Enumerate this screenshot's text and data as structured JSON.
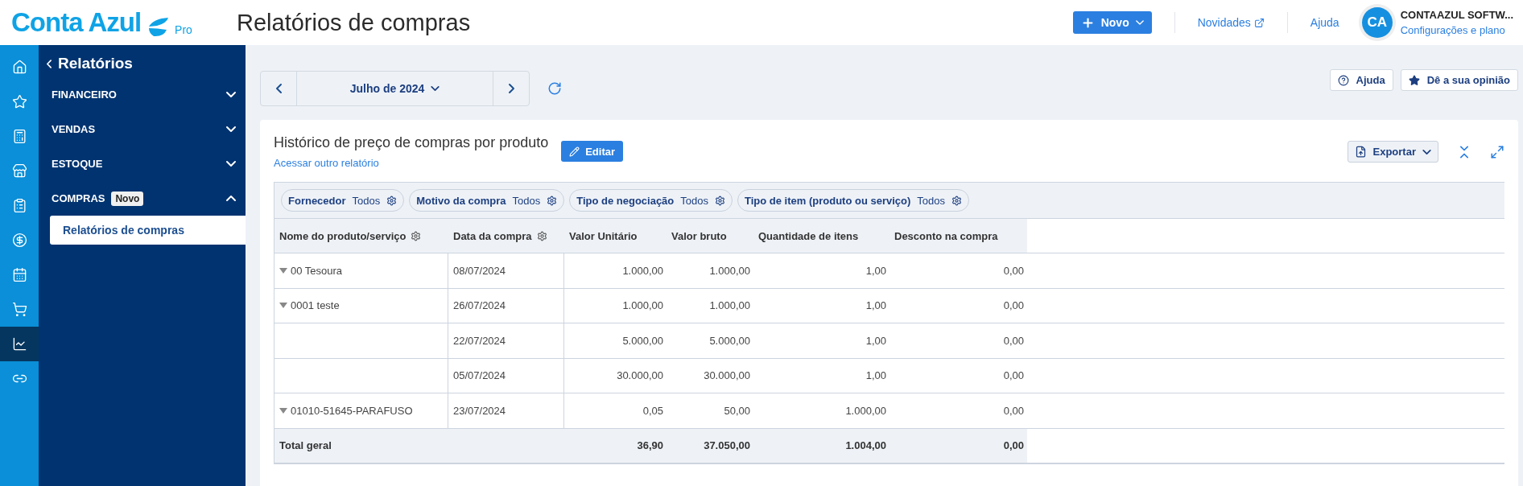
{
  "header": {
    "logo": {
      "text": "Conta Azul",
      "tier": "Pro"
    },
    "page_title": "Relatórios de compras",
    "new_button": "Novo",
    "links": [
      {
        "label": "Novidades",
        "external": true
      },
      {
        "label": "Ajuda",
        "external": false
      }
    ],
    "user": {
      "initials": "CA",
      "name": "CONTAAZUL SOFTW...",
      "subtitle": "Configurações e plano"
    }
  },
  "rail": {
    "items": [
      {
        "kind": "home",
        "selected": false
      },
      {
        "kind": "star",
        "selected": false
      },
      {
        "kind": "register",
        "selected": false
      },
      {
        "kind": "store",
        "selected": false
      },
      {
        "kind": "clipboard",
        "selected": false
      },
      {
        "kind": "money",
        "selected": false
      },
      {
        "kind": "calendar",
        "selected": false
      },
      {
        "kind": "cart",
        "selected": false
      },
      {
        "kind": "chart",
        "selected": true
      },
      {
        "kind": "link",
        "selected": false
      }
    ]
  },
  "nav": {
    "title": "Relatórios",
    "sections": [
      {
        "label": "FINANCEIRO",
        "expanded": false
      },
      {
        "label": "VENDAS",
        "expanded": false
      },
      {
        "label": "ESTOQUE",
        "expanded": false
      },
      {
        "label": "COMPRAS",
        "badge": "Novo",
        "expanded": true,
        "children": [
          {
            "label": "Relatórios de compras",
            "selected": true
          }
        ]
      }
    ]
  },
  "toolbar": {
    "period": "Julho de 2024",
    "actions": [
      {
        "kind": "help",
        "label": "Ajuda"
      },
      {
        "kind": "feedback",
        "label": "Dê a sua opinião"
      }
    ]
  },
  "report": {
    "title": "Histórico de preço de compras por produto",
    "link": "Acessar outro relatório",
    "edit_button": "Editar",
    "export_button": "Exportar",
    "filters": [
      {
        "label": "Fornecedor",
        "value": "Todos"
      },
      {
        "label": "Motivo da compra",
        "value": "Todos"
      },
      {
        "label": "Tipo de negociação",
        "value": "Todos"
      },
      {
        "label": "Tipo de item (produto ou serviço)",
        "value": "Todos"
      }
    ],
    "columns": [
      {
        "label": "Nome do produto/serviço",
        "settings": true
      },
      {
        "label": "Data da compra",
        "settings": true
      },
      {
        "label": "Valor Unitário",
        "settings": false
      },
      {
        "label": "Valor bruto",
        "settings": false
      },
      {
        "label": "Quantidade de itens",
        "settings": false
      },
      {
        "label": "Desconto na compra",
        "settings": false
      }
    ],
    "rows": [
      {
        "name": "00 Tesoura",
        "expanded": true,
        "date": "08/07/2024",
        "unit": "1.000,00",
        "gross": "1.000,00",
        "qty": "1,00",
        "discount": "0,00"
      },
      {
        "name": "0001 teste",
        "expanded": true,
        "date": "26/07/2024",
        "unit": "1.000,00",
        "gross": "1.000,00",
        "qty": "1,00",
        "discount": "0,00"
      },
      {
        "date": "22/07/2024",
        "unit": "5.000,00",
        "gross": "5.000,00",
        "qty": "1,00",
        "discount": "0,00"
      },
      {
        "date": "05/07/2024",
        "unit": "30.000,00",
        "gross": "30.000,00",
        "qty": "1,00",
        "discount": "0,00"
      },
      {
        "name": "01010-51645-PARAFUSO",
        "expanded": true,
        "date": "23/07/2024",
        "unit": "0,05",
        "gross": "50,00",
        "qty": "1.000,00",
        "discount": "0,00"
      }
    ],
    "total": {
      "label": "Total geral",
      "unit": "36,90",
      "gross": "37.050,00",
      "qty": "1.004,00",
      "discount": "0,00"
    }
  }
}
